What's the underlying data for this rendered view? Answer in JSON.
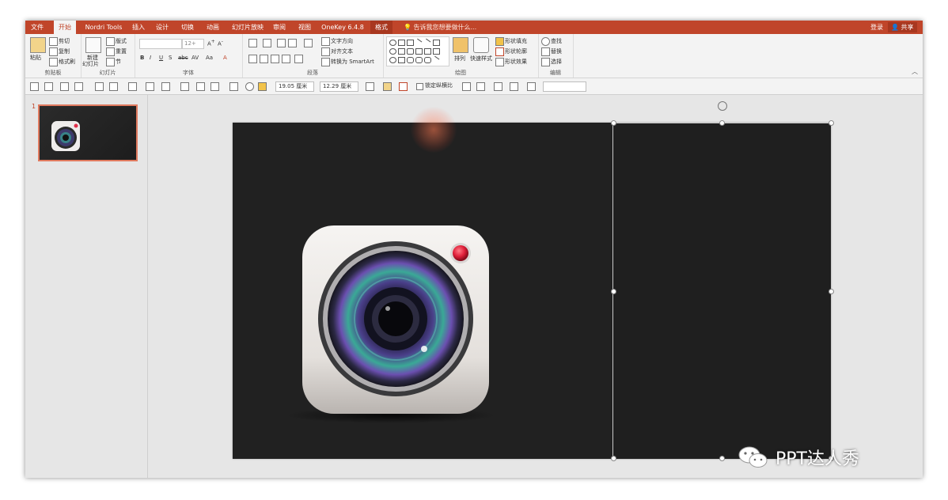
{
  "tabs": [
    "文件",
    "开始",
    "Nordri Tools",
    "插入",
    "设计",
    "切换",
    "动画",
    "幻灯片放映",
    "审阅",
    "视图",
    "OneKey 6.4.8",
    "格式"
  ],
  "active_tab_index": 1,
  "tell_me": "告诉我您想要做什么...",
  "login": "登录",
  "share": "共享",
  "ribbon": {
    "clipboard": {
      "paste": "粘贴",
      "cut": "剪切",
      "copy": "复制",
      "format_painter": "格式刷",
      "label": "剪贴板"
    },
    "slides": {
      "new_slide": "新建",
      "new_slide_2": "幻灯片",
      "layout": "版式",
      "reset": "重置",
      "section": "节",
      "label": "幻灯片"
    },
    "font": {
      "size_value": "12+",
      "bold": "B",
      "italic": "I",
      "underline": "U",
      "shadow": "S",
      "strike": "abc",
      "spacing": "AV",
      "case": "Aa",
      "color": "A",
      "label": "字体"
    },
    "paragraph": {
      "text_direction": "文字方向",
      "align_text": "对齐文本",
      "smartart": "转换为 SmartArt",
      "label": "段落"
    },
    "drawing": {
      "arrange": "排列",
      "quick_styles": "快速样式",
      "fill": "形状填充",
      "outline": "形状轮廓",
      "effects": "形状效果",
      "label": "绘图"
    },
    "editing": {
      "find": "查找",
      "replace": "替换",
      "select": "选择",
      "label": "编辑"
    }
  },
  "format_bar": {
    "width": "19.05 厘米",
    "height": "12.29 厘米",
    "lock_ratio": "锁定纵横比"
  },
  "slide_number": "1",
  "watermark": "PPT达人秀",
  "colors": {
    "accent": "#c0452a",
    "canvas": "#212121"
  }
}
